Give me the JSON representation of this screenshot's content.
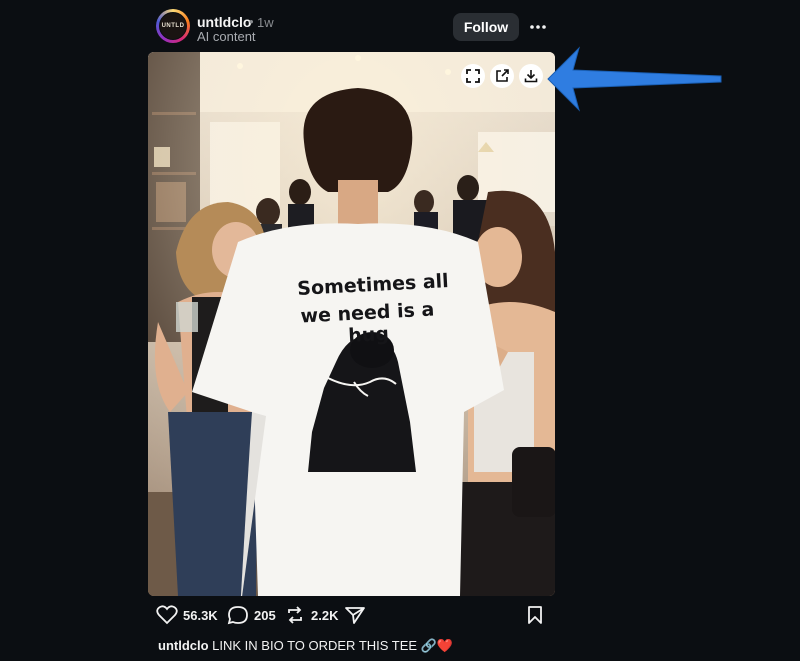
{
  "post": {
    "username": "untldclo",
    "separator": "•",
    "time_ago": "1w",
    "sublabel": "AI content",
    "avatar_text": "UNTLD",
    "follow_label": "Follow",
    "more_icon": "ellipsis-icon"
  },
  "image": {
    "shirt_text_line1": "Sometimes all",
    "shirt_text_line2": "we need is a hug",
    "overlay_buttons": [
      "fullscreen-icon",
      "open-external-icon",
      "download-icon"
    ]
  },
  "actions": {
    "likes": "56.3K",
    "comments": "205",
    "reposts": "2.2K"
  },
  "caption": {
    "username": "untldclo",
    "text": "LINK IN BIO TO ORDER THIS TEE 🔗❤️"
  },
  "colors": {
    "background": "#0b0e12",
    "follow_bg": "#2a2e33",
    "annotation_arrow": "#2f7de1"
  }
}
